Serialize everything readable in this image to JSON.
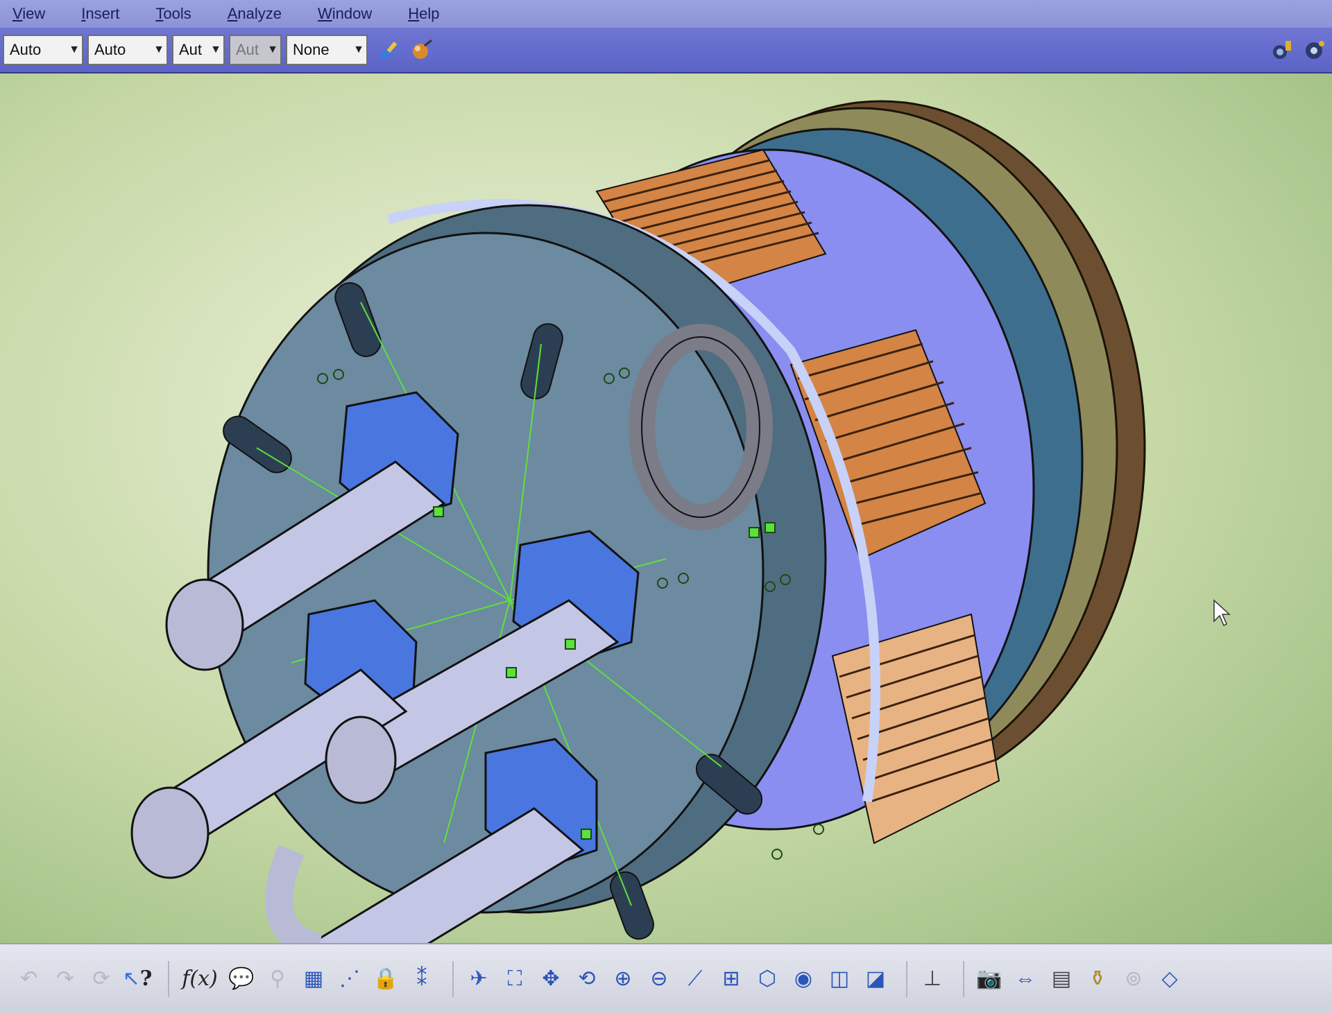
{
  "menubar": {
    "items": [
      "View",
      "Insert",
      "Tools",
      "Analyze",
      "Window",
      "Help"
    ]
  },
  "toolbar": {
    "combos": [
      {
        "value": "Auto",
        "enabled": true
      },
      {
        "value": "Auto",
        "enabled": true
      },
      {
        "value": "Aut",
        "enabled": true
      },
      {
        "value": "Aut",
        "enabled": false
      },
      {
        "value": "None",
        "enabled": true
      }
    ],
    "icons": [
      "paint-brush-icon",
      "material-sphere-icon"
    ],
    "right_icons": [
      "apply-material-icon",
      "render-settings-icon"
    ]
  },
  "bottombar": {
    "formula_label": "f(x)",
    "help_label": "?"
  },
  "colors": {
    "menubar": "#9ba2e0",
    "toolbar": "#5b63c6",
    "part_face": "#6c8aa0",
    "nut_blue": "#4a76e0",
    "coil_copper": "#d48444",
    "constraint_green": "#5ce13c"
  }
}
